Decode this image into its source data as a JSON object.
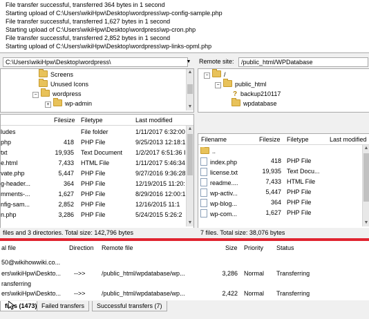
{
  "log": {
    "lines": [
      "File transfer successful, transferred 364 bytes in 1 second",
      "Starting upload of C:\\Users\\wikiHpw\\Desktop\\wordpress\\wp-config-sample.php",
      "File transfer successful, transferred 1,627 bytes in 1 second",
      "Starting upload of C:\\Users\\wikiHpw\\Desktop\\wordpress\\wp-cron.php",
      "File transfer successful, transferred 2,852 bytes in 1 second",
      "Starting upload of C:\\Users\\wikiHpw\\Desktop\\wordpress\\wp-links-opml.php"
    ]
  },
  "local": {
    "path": "C:\\Users\\wikiHpw\\Desktop\\wordpress\\",
    "tree": [
      "Screens",
      "Unused Icons",
      "wordpress",
      "wp-admin"
    ],
    "headers": {
      "name": "",
      "size": "Filesize",
      "type": "Filetype",
      "modified": "Last modified"
    },
    "rows": [
      {
        "name": "ludes",
        "size": "",
        "type": "File folder",
        "modified": "1/11/2017 6:32:00"
      },
      {
        "name": "php",
        "size": "418",
        "type": "PHP File",
        "modified": "9/25/2013 12:18:1"
      },
      {
        "name": "txt",
        "size": "19,935",
        "type": "Text Document",
        "modified": "1/2/2017 6:51:36 I"
      },
      {
        "name": "e.html",
        "size": "7,433",
        "type": "HTML File",
        "modified": "1/11/2017 5:46:34"
      },
      {
        "name": "vate.php",
        "size": "5,447",
        "type": "PHP File",
        "modified": "9/27/2016 9:36:28"
      },
      {
        "name": "g-header...",
        "size": "364",
        "type": "PHP File",
        "modified": "12/19/2015 11:20:"
      },
      {
        "name": "mments-...",
        "size": "1,627",
        "type": "PHP File",
        "modified": "8/29/2016 12:00:1"
      },
      {
        "name": "nfig-sam...",
        "size": "2,852",
        "type": "PHP File",
        "modified": "12/16/2015 11:1"
      },
      {
        "name": "n.php",
        "size": "3,286",
        "type": "PHP File",
        "modified": "5/24/2015 5:26:2"
      }
    ],
    "status": "files and 3 directories. Total size: 142,796 bytes"
  },
  "remote": {
    "label": "Remote site:",
    "path": "/public_html/WPDatabase",
    "tree": [
      "/",
      "public_html",
      "backup210117",
      "wpdatabase"
    ],
    "headers": {
      "name": "Filename",
      "size": "Filesize",
      "type": "Filetype",
      "modified": "Last modified"
    },
    "rows": [
      {
        "name": "..",
        "size": "",
        "type": "",
        "modified": ""
      },
      {
        "name": "index.php",
        "size": "418",
        "type": "PHP File",
        "modified": ""
      },
      {
        "name": "license.txt",
        "size": "19,935",
        "type": "Text Docu...",
        "modified": ""
      },
      {
        "name": "readme....",
        "size": "7,433",
        "type": "HTML File",
        "modified": ""
      },
      {
        "name": "wp-activ...",
        "size": "5,447",
        "type": "PHP File",
        "modified": ""
      },
      {
        "name": "wp-blog...",
        "size": "364",
        "type": "PHP File",
        "modified": ""
      },
      {
        "name": "wp-com...",
        "size": "1,627",
        "type": "PHP File",
        "modified": ""
      }
    ],
    "status": "7 files. Total size: 38,076 bytes"
  },
  "queue": {
    "headers": {
      "local": "al file",
      "direction": "Direction",
      "remote": "Remote file",
      "size": "Size",
      "priority": "Priority",
      "status": "Status"
    },
    "rows": [
      {
        "local": "50@wikihowwiki.co...",
        "direction": "",
        "remote": "",
        "size": "",
        "priority": "",
        "status": ""
      },
      {
        "local": "ers\\wikiHpw\\Deskto...",
        "direction": "-->>",
        "remote": "/public_html/wpdatabase/wp...",
        "size": "3,286",
        "priority": "Normal",
        "status": "Transferring"
      },
      {
        "local": "ransferring",
        "direction": "",
        "remote": "",
        "size": "",
        "priority": "",
        "status": ""
      },
      {
        "local": "ers\\wikiHpw\\Deskto...",
        "direction": "-->>",
        "remote": "/public_html/wpdatabase/wp...",
        "size": "2,422",
        "priority": "Normal",
        "status": "Transferring"
      }
    ]
  },
  "tabs": [
    "files (1473)",
    "Failed transfers",
    "Successful transfers (7)"
  ],
  "colors": {
    "divider": "#e02430",
    "selection": "#cce8ff"
  }
}
